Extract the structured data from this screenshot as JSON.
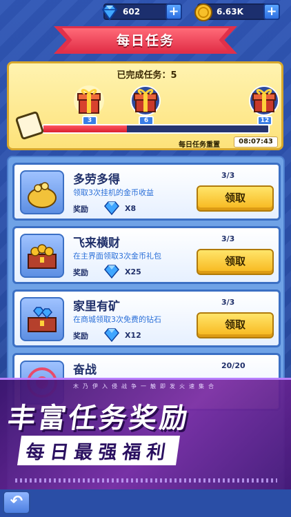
{
  "resources": {
    "gems": "602",
    "coins": "6.63K",
    "plus_label": "+"
  },
  "title": "每日任务",
  "progress": {
    "completed_label": "已完成任务：5",
    "fill_fraction": 0.37,
    "milestones": [
      "3",
      "6",
      "12"
    ],
    "reset_label": "每日任务重置",
    "reset_time": "08:07:43"
  },
  "tasks": [
    {
      "name": "多劳多得",
      "desc": "领取3次挂机的金币收益",
      "reward_label": "奖励",
      "reward_count": "X8",
      "progress": "3/3",
      "button": "领取",
      "icon": "coin-bag-icon"
    },
    {
      "name": "飞来横财",
      "desc": "在主界面领取3次金币礼包",
      "reward_label": "奖励",
      "reward_count": "X25",
      "progress": "3/3",
      "button": "领取",
      "icon": "coin-chest-icon"
    },
    {
      "name": "家里有矿",
      "desc": "在商城领取3次免费的钻石",
      "reward_label": "奖励",
      "reward_count": "X12",
      "progress": "3/3",
      "button": "领取",
      "icon": "gem-chest-icon"
    },
    {
      "name": "奋战",
      "desc": "",
      "reward_label": "",
      "reward_count": "",
      "progress": "20/20",
      "button": "",
      "icon": "target-icon"
    }
  ],
  "promo": {
    "tagline": "木乃伊入侵战争一触即发火速集合",
    "line1": "丰富任务奖励",
    "line2": "每日最强福利"
  },
  "nav": {
    "back_label": "↶"
  },
  "colors": {
    "accent_red": "#e23048",
    "button_yellow": "#f7b61b",
    "panel_blue": "#2f56b5"
  }
}
